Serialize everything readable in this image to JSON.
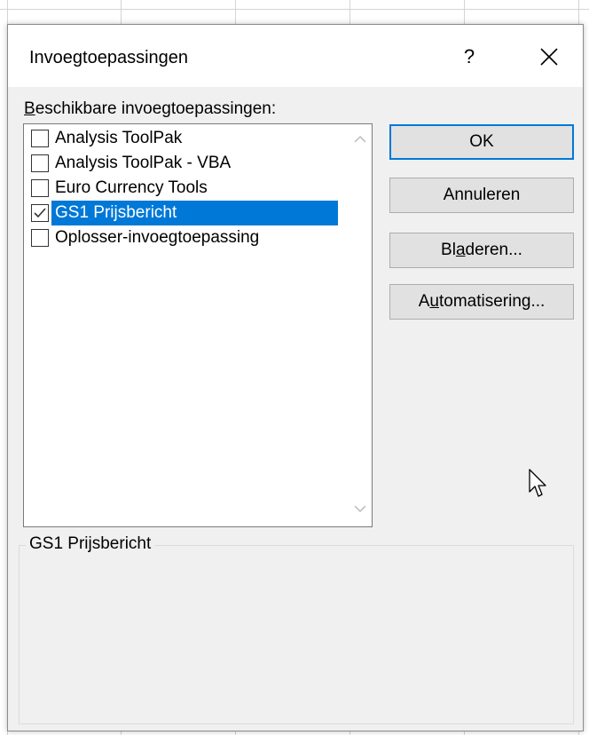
{
  "dialog": {
    "title": "Invoegtoepassingen",
    "help_label": "?",
    "close_label": "✕"
  },
  "list": {
    "label_accel": "B",
    "label_rest": "eschikbare invoegtoepassingen:",
    "items": [
      {
        "label": "Analysis ToolPak",
        "checked": false,
        "selected": false
      },
      {
        "label": "Analysis ToolPak - VBA",
        "checked": false,
        "selected": false
      },
      {
        "label": "Euro Currency Tools",
        "checked": false,
        "selected": false
      },
      {
        "label": "GS1 Prijsbericht",
        "checked": true,
        "selected": true
      },
      {
        "label": "Oplosser-invoegtoepassing",
        "checked": false,
        "selected": false
      }
    ]
  },
  "buttons": {
    "ok": "OK",
    "cancel": "Annuleren",
    "browse_pre": "Bl",
    "browse_accel": "a",
    "browse_post": "deren...",
    "automation_pre": "A",
    "automation_accel": "u",
    "automation_post": "tomatisering..."
  },
  "description": {
    "title": "GS1 Prijsbericht"
  },
  "colors": {
    "selection": "#0078d7",
    "dialog_bg": "#f0f0f0",
    "button_bg": "#e1e1e1"
  }
}
